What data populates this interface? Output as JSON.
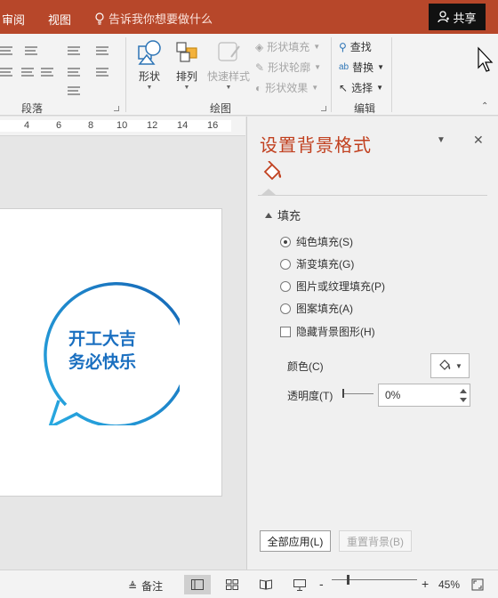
{
  "tabs": {
    "review": "审阅",
    "view": "视图",
    "tell_me": "告诉我你想要做什么",
    "share": "共享"
  },
  "ribbon": {
    "paragraph_label": "段落",
    "drawing_label": "绘图",
    "editing_label": "编辑",
    "shapes": "形状",
    "arrange": "排列",
    "quick_styles": "快速样式",
    "shape_fill": "形状填充",
    "shape_outline": "形状轮廓",
    "shape_effects": "形状效果",
    "find": "查找",
    "replace": "替换",
    "select": "选择"
  },
  "ruler": {
    "numbers": [
      "4",
      "6",
      "8",
      "10",
      "12",
      "14",
      "16"
    ]
  },
  "slide": {
    "line1": "开工大吉",
    "line2": "务必快乐",
    "bubble_color_light": "#29abe2",
    "bubble_color_dark": "#1565b5"
  },
  "pane": {
    "title": "设置背景格式",
    "section": "填充",
    "options": {
      "solid": "纯色填充(S)",
      "gradient": "渐变填充(G)",
      "picture": "图片或纹理填充(P)",
      "pattern": "图案填充(A)",
      "hide_graphics": "隐藏背景图形(H)"
    },
    "selected_option": "纯色填充(S)",
    "hide_graphics_checked": false,
    "color_label": "颜色(C)",
    "transparency_label": "透明度(T)",
    "transparency_value": "0%",
    "apply_all": "全部应用(L)",
    "reset": "重置背景(B)"
  },
  "status": {
    "notes": "备注",
    "zoom": "45%",
    "minus": "-",
    "plus": "+"
  },
  "colors": {
    "accent": "#b7472a",
    "pane_title": "#c1401f",
    "text_blue": "#1a6fc0"
  }
}
